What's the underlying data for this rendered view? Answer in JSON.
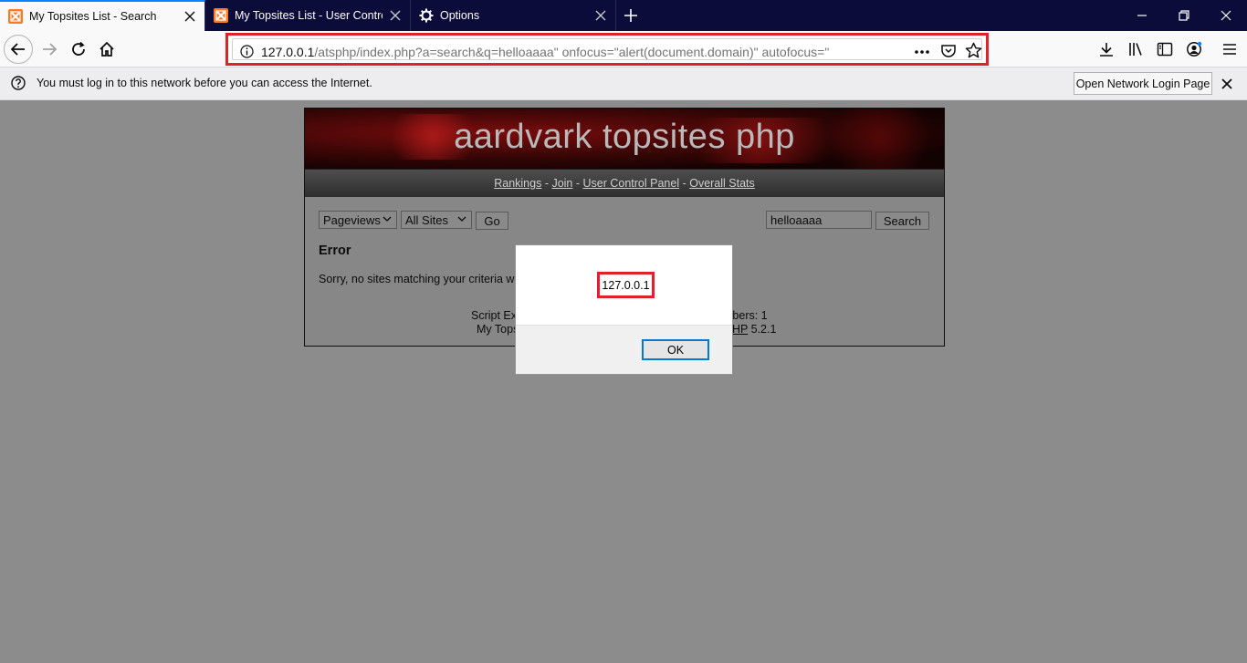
{
  "browser": {
    "tabs": [
      {
        "title": "My Topsites List - Search",
        "active": true
      },
      {
        "title": "My Topsites List - User Control",
        "active": false
      },
      {
        "title": "Options",
        "active": false
      }
    ],
    "url": {
      "host": "127.0.0.1",
      "rest": "/atsphp/index.php?a=search&q=helloaaaa\" onfocus=\"alert(document.domain)\" autofocus=\""
    },
    "notification": {
      "message": "You must log in to this network before you can access the Internet.",
      "button": "Open Network Login Page"
    }
  },
  "page": {
    "banner_title": "aardvark topsites php",
    "nav_links": [
      "Rankings",
      "Join",
      "User Control Panel",
      "Overall Stats"
    ],
    "nav_separator": " - ",
    "filters": {
      "sort": "Pageviews",
      "category": "All Sites",
      "go_label": "Go"
    },
    "search": {
      "value": "helloaaaa",
      "button": "Search"
    },
    "error_heading": "Error",
    "error_text": "Sorry, no sites matching your criteria we",
    "footer": {
      "line1_left": "Script Ex",
      "line1_right": "mbers: 1",
      "line2_left": "My Tops",
      "line2_link": "HP",
      "line2_right": " 5.2.1"
    }
  },
  "dialog": {
    "message": "127.0.0.1",
    "ok_label": "OK"
  },
  "colors": {
    "highlight": "#e0202a",
    "tabbar": "#0c0c3a",
    "accent": "#0a84ff"
  }
}
